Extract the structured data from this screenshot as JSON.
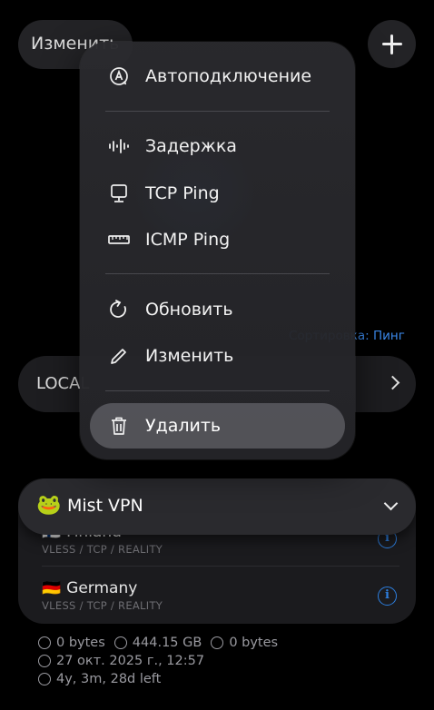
{
  "header": {
    "edit_chip_label": "Изменить",
    "add_icon": "plus-icon"
  },
  "context_menu": {
    "items": [
      {
        "label": "Автоподключение",
        "icon": "auto-connect-icon"
      },
      {
        "label": "Задержка",
        "icon": "latency-waveform-icon"
      },
      {
        "label": "TCP Ping",
        "icon": "monitor-icon"
      },
      {
        "label": "ICMP Ping",
        "icon": "ruler-icon"
      },
      {
        "label": "Обновить",
        "icon": "refresh-icon"
      },
      {
        "label": "Изменить",
        "icon": "pencil-icon"
      },
      {
        "label": "Удалить",
        "icon": "trash-icon"
      }
    ]
  },
  "sort_label": "Сортировка: Пинг",
  "local_group": {
    "label": "LOCAL"
  },
  "subscription": {
    "emoji": "🐸",
    "name": "Mist VPN",
    "servers": [
      {
        "flag": "🇫🇮",
        "name": "Finland",
        "protocol": "VLESS / TCP / REALITY"
      },
      {
        "flag": "🇩🇪",
        "name": "Germany",
        "protocol": "VLESS / TCP / REALITY"
      }
    ]
  },
  "stats": {
    "upload": "0 bytes",
    "download": "444.15 GB",
    "total": "0 bytes",
    "updated": "27 окт. 2025 г., 12:57",
    "expires": "4y, 3m, 28d left"
  },
  "colors": {
    "accent": "#2d7fe0",
    "background": "#000000",
    "menu_bg": "#2a2a2e"
  }
}
